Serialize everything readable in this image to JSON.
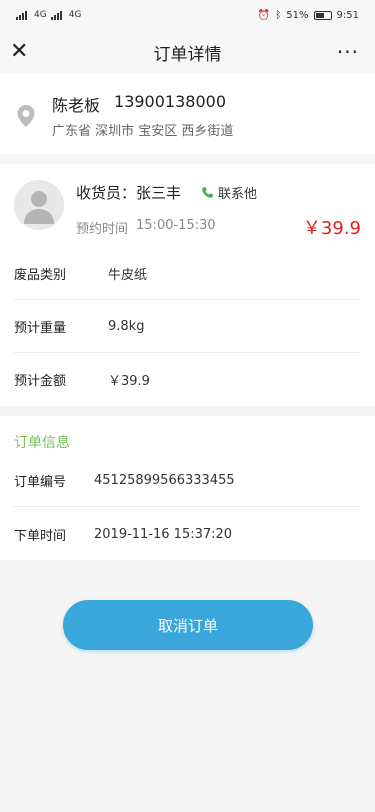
{
  "status_bar": {
    "signal1": "4G",
    "signal2": "4G",
    "battery": "51%",
    "time": "9:51"
  },
  "nav": {
    "title": "订单详情",
    "close_icon": "close-icon",
    "more_icon": "more-icon"
  },
  "address": {
    "name": "陈老板",
    "phone": "13900138000",
    "detail": "广东省 深圳市 宝安区 西乡街道"
  },
  "courier": {
    "label": "收货员：张三丰",
    "contact": "联系他",
    "time_label": "预约时间",
    "time_value": "15:00-15:30",
    "price": "￥39.9"
  },
  "details": [
    {
      "label": "废品类别",
      "value": "牛皮纸"
    },
    {
      "label": "预计重量",
      "value": "9.8kg"
    },
    {
      "label": "预计金额",
      "value": "￥39.9"
    }
  ],
  "order": {
    "title": "订单信息",
    "rows": [
      {
        "label": "订单编号",
        "value": "45125899566333455"
      },
      {
        "label": "下单时间",
        "value": "2019-11-16  15:37:20"
      }
    ]
  },
  "cancel_button": "取消订单",
  "colors": {
    "accent": "#3aa7dc",
    "price": "#e02020",
    "section_title": "#7ac05a",
    "phone_icon": "#4caf50"
  }
}
